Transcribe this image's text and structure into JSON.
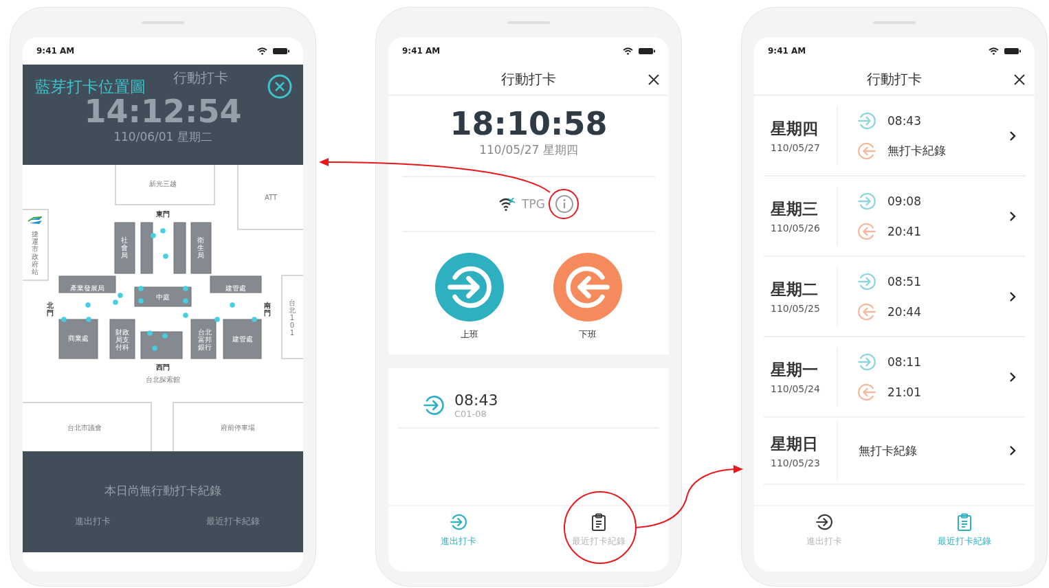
{
  "screens": [
    {
      "kind": "map_overlay",
      "status_time": "9:41 AM",
      "overlay_title": "藍芽打卡位置圖",
      "background": {
        "title": "行動打卡",
        "clock": "14:12:54",
        "date": "110/06/01 星期二",
        "empty_message": "本日尚無行動打卡紀錄",
        "nav": [
          "進出打卡",
          "最近打卡紀錄"
        ]
      },
      "map_labels": [
        {
          "kind": "horizontal",
          "text": "新光三越"
        },
        {
          "kind": "horizontal",
          "text": "ATT"
        },
        {
          "kind": "horizontal",
          "text": "東門"
        },
        {
          "kind": "vertical",
          "text": "社會局"
        },
        {
          "kind": "vertical",
          "text": "衛生局"
        },
        {
          "kind": "horizontal",
          "text": "產業發展局"
        },
        {
          "kind": "horizontal",
          "text": "中庭"
        },
        {
          "kind": "horizontal",
          "text": "建管處"
        },
        {
          "kind": "vertical",
          "text": "北門"
        },
        {
          "kind": "vertical",
          "text": "南門"
        },
        {
          "kind": "horizontal",
          "text": "商業處"
        },
        {
          "kind": "block",
          "text": "財政局支付科"
        },
        {
          "kind": "block",
          "text": "台北富邦銀行"
        },
        {
          "kind": "horizontal",
          "text": "建管處"
        },
        {
          "kind": "horizontal",
          "text": "西門"
        },
        {
          "kind": "horizontal",
          "text": "台北探索館"
        },
        {
          "kind": "horizontal",
          "text": "台北市議會"
        },
        {
          "kind": "horizontal",
          "text": "府前停車場"
        },
        {
          "kind": "vertical",
          "text": "捷運市政府站"
        },
        {
          "kind": "vertical",
          "text": "台北101"
        }
      ]
    },
    {
      "kind": "punch",
      "status_time": "9:41 AM",
      "title": "行動打卡",
      "clock": "18:10:58",
      "date": "110/05/27 星期四",
      "network": "TPG",
      "actions": [
        {
          "kind": "in",
          "label": "上班"
        },
        {
          "kind": "out",
          "label": "下班"
        }
      ],
      "records": [
        {
          "kind": "in",
          "time": "08:43",
          "location": "C01-08"
        }
      ],
      "nav": [
        {
          "kind": "punch",
          "label": "進出打卡",
          "selected": true
        },
        {
          "kind": "history",
          "label": "最近打卡紀錄",
          "selected": false
        }
      ]
    },
    {
      "kind": "history",
      "status_time": "9:41 AM",
      "title": "行動打卡",
      "days": [
        {
          "weekday": "星期四",
          "date": "110/05/27",
          "punches": [
            {
              "kind": "in",
              "text": "08:43"
            },
            {
              "kind": "out",
              "text": "無打卡紀錄"
            }
          ]
        },
        {
          "weekday": "星期三",
          "date": "110/05/26",
          "punches": [
            {
              "kind": "in",
              "text": "09:08"
            },
            {
              "kind": "out",
              "text": "20:41"
            }
          ]
        },
        {
          "weekday": "星期二",
          "date": "110/05/25",
          "punches": [
            {
              "kind": "in",
              "text": "08:51"
            },
            {
              "kind": "out",
              "text": "20:44"
            }
          ]
        },
        {
          "weekday": "星期一",
          "date": "110/05/24",
          "punches": [
            {
              "kind": "in",
              "text": "08:11"
            },
            {
              "kind": "out",
              "text": "21:01"
            }
          ]
        },
        {
          "weekday": "星期日",
          "date": "110/05/23",
          "note": "無打卡紀錄"
        }
      ],
      "nav": [
        {
          "kind": "punch",
          "label": "進出打卡",
          "selected": false
        },
        {
          "kind": "history",
          "label": "最近打卡紀錄",
          "selected": true
        }
      ]
    }
  ]
}
